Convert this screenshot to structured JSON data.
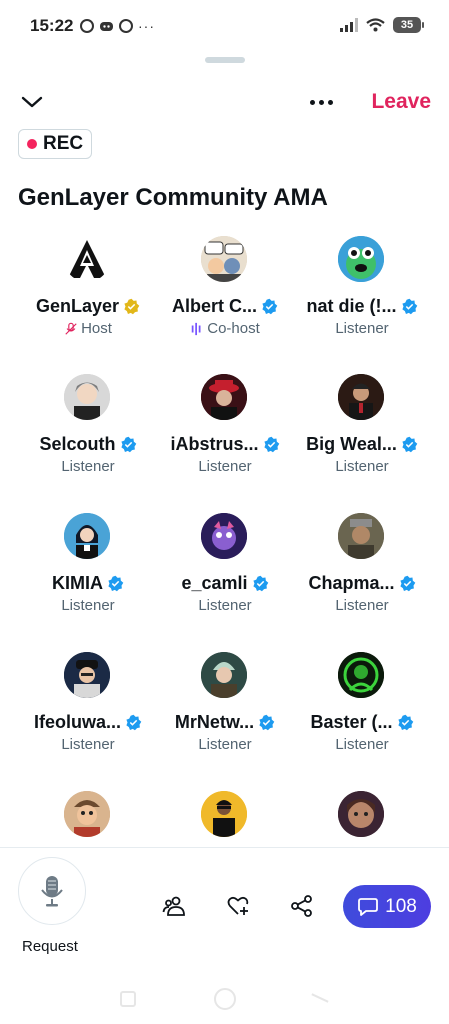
{
  "status_bar": {
    "time": "15:22",
    "notification_icons": [
      "whatsapp-icon",
      "discord-icon",
      "whatsapp-icon"
    ],
    "more": "···",
    "battery": "35"
  },
  "header": {
    "leave_label": "Leave",
    "rec_label": "REC",
    "title": "GenLayer Community AMA"
  },
  "participants": [
    {
      "name": "GenLayer",
      "role": "Host",
      "badge": "gold",
      "role_icon": "muted-mic-icon"
    },
    {
      "name": "Albert C...",
      "role": "Co-host",
      "badge": "blue",
      "role_icon": "speaking-icon"
    },
    {
      "name": "nat die (!...",
      "role": "Listener",
      "badge": "blue"
    },
    {
      "name": "Selcouth",
      "role": "Listener",
      "badge": "blue"
    },
    {
      "name": "iAbstrus...",
      "role": "Listener",
      "badge": "blue"
    },
    {
      "name": "Big Weal...",
      "role": "Listener",
      "badge": "blue"
    },
    {
      "name": "KIMIA",
      "role": "Listener",
      "badge": "blue"
    },
    {
      "name": "e_camli",
      "role": "Listener",
      "badge": "blue"
    },
    {
      "name": "Chapma...",
      "role": "Listener",
      "badge": "blue"
    },
    {
      "name": "Ifeoluwa...",
      "role": "Listener",
      "badge": "blue"
    },
    {
      "name": "MrNetw...",
      "role": "Listener",
      "badge": "blue"
    },
    {
      "name": "Baster (...",
      "role": "Listener",
      "badge": "blue"
    },
    {
      "name": "",
      "role": "",
      "badge": ""
    },
    {
      "name": "",
      "role": "",
      "badge": ""
    },
    {
      "name": "",
      "role": "",
      "badge": ""
    }
  ],
  "bottom_bar": {
    "request_label": "Request",
    "chat_count": "108"
  },
  "colors": {
    "leave": "#e0245e",
    "rec_dot": "#f4245e",
    "verified_blue": "#1d9bf0",
    "verified_gold": "#e2b719",
    "chat_pill": "#4545de",
    "cohost_accent": "#7856ff"
  }
}
